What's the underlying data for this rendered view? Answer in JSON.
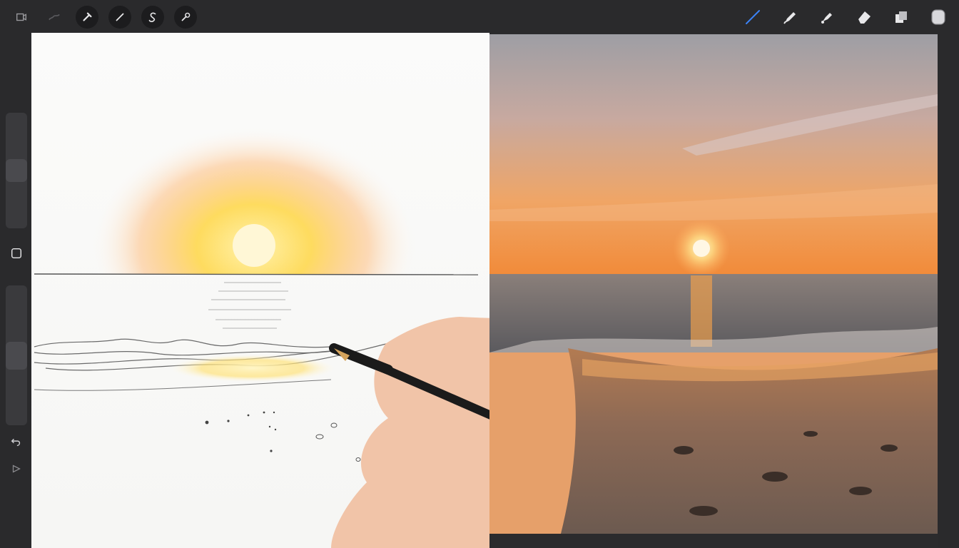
{
  "toolbar": {
    "left_tools": [
      {
        "icon": "gallery-icon"
      },
      {
        "icon": "actions-wrench-icon"
      },
      {
        "icon": "adjustments-wand-icon"
      },
      {
        "icon": "selection-s-icon"
      },
      {
        "icon": "transform-arrow-icon"
      },
      {
        "icon": "modify-icon"
      }
    ],
    "right_tools": [
      {
        "icon": "brush-stroke-icon",
        "active": true
      },
      {
        "icon": "smudge-icon"
      },
      {
        "icon": "eraser-pen-icon"
      },
      {
        "icon": "eraser-icon"
      },
      {
        "icon": "layers-icon"
      },
      {
        "icon": "color-swatch-icon"
      }
    ]
  },
  "sidebar": {
    "brush_size_level": 0.5,
    "opacity_level": 0.5,
    "buttons": [
      {
        "icon": "square-modify-icon"
      },
      {
        "icon": "undo-icon"
      },
      {
        "icon": "redo-icon"
      }
    ]
  },
  "colors": {
    "toolbar_bg": "#2a2a2c",
    "active_tool": "#3b82f6",
    "paper": "#f8f8f6",
    "sun_core": "#fff6d0",
    "sun_glow": "#ffc94a",
    "sky_top": "#9a9aa0",
    "sky_horizon": "#f09a48",
    "sea": "#6f6b6a",
    "sand": "#8a6a55"
  }
}
